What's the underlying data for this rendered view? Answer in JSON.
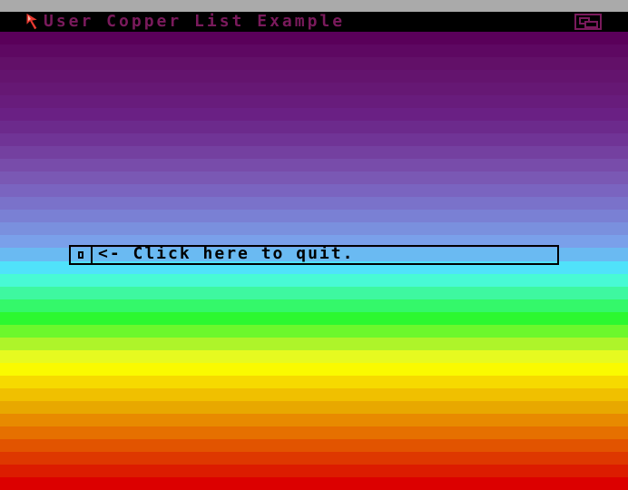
{
  "window": {
    "title": "User Copper List Example"
  },
  "gadget": {
    "label": "<- Click here to quit."
  },
  "icons": {
    "pointer": "mouse-pointer-icon",
    "depth": "depth-arrange-icon",
    "close": "close-box-icon"
  },
  "colors": {
    "screen_bar": "#aaaaaa",
    "title_bar": "#000000",
    "title_text": "#7a1a5c",
    "gadget_outline": "#000000",
    "pointer": "#e83a30",
    "copper_gradient": [
      "#5a005a",
      "#5e0862",
      "#621068",
      "#64146e",
      "#661874",
      "#681c7c",
      "#6a2084",
      "#6c2a8c",
      "#703496",
      "#7440a0",
      "#784caa",
      "#7a58b4",
      "#7a64c0",
      "#7a72ca",
      "#7a80d4",
      "#7a90de",
      "#7aa0ea",
      "#6abaf2",
      "#50e2fa",
      "#48fad4",
      "#3ef8a0",
      "#34f86a",
      "#2cf830",
      "#6cf82c",
      "#aef42a",
      "#e6fa20",
      "#fafa00",
      "#f6da00",
      "#f0c000",
      "#e8a800",
      "#e88a00",
      "#e67000",
      "#e25400",
      "#de3800",
      "#dc1c00",
      "#dc0000"
    ]
  }
}
